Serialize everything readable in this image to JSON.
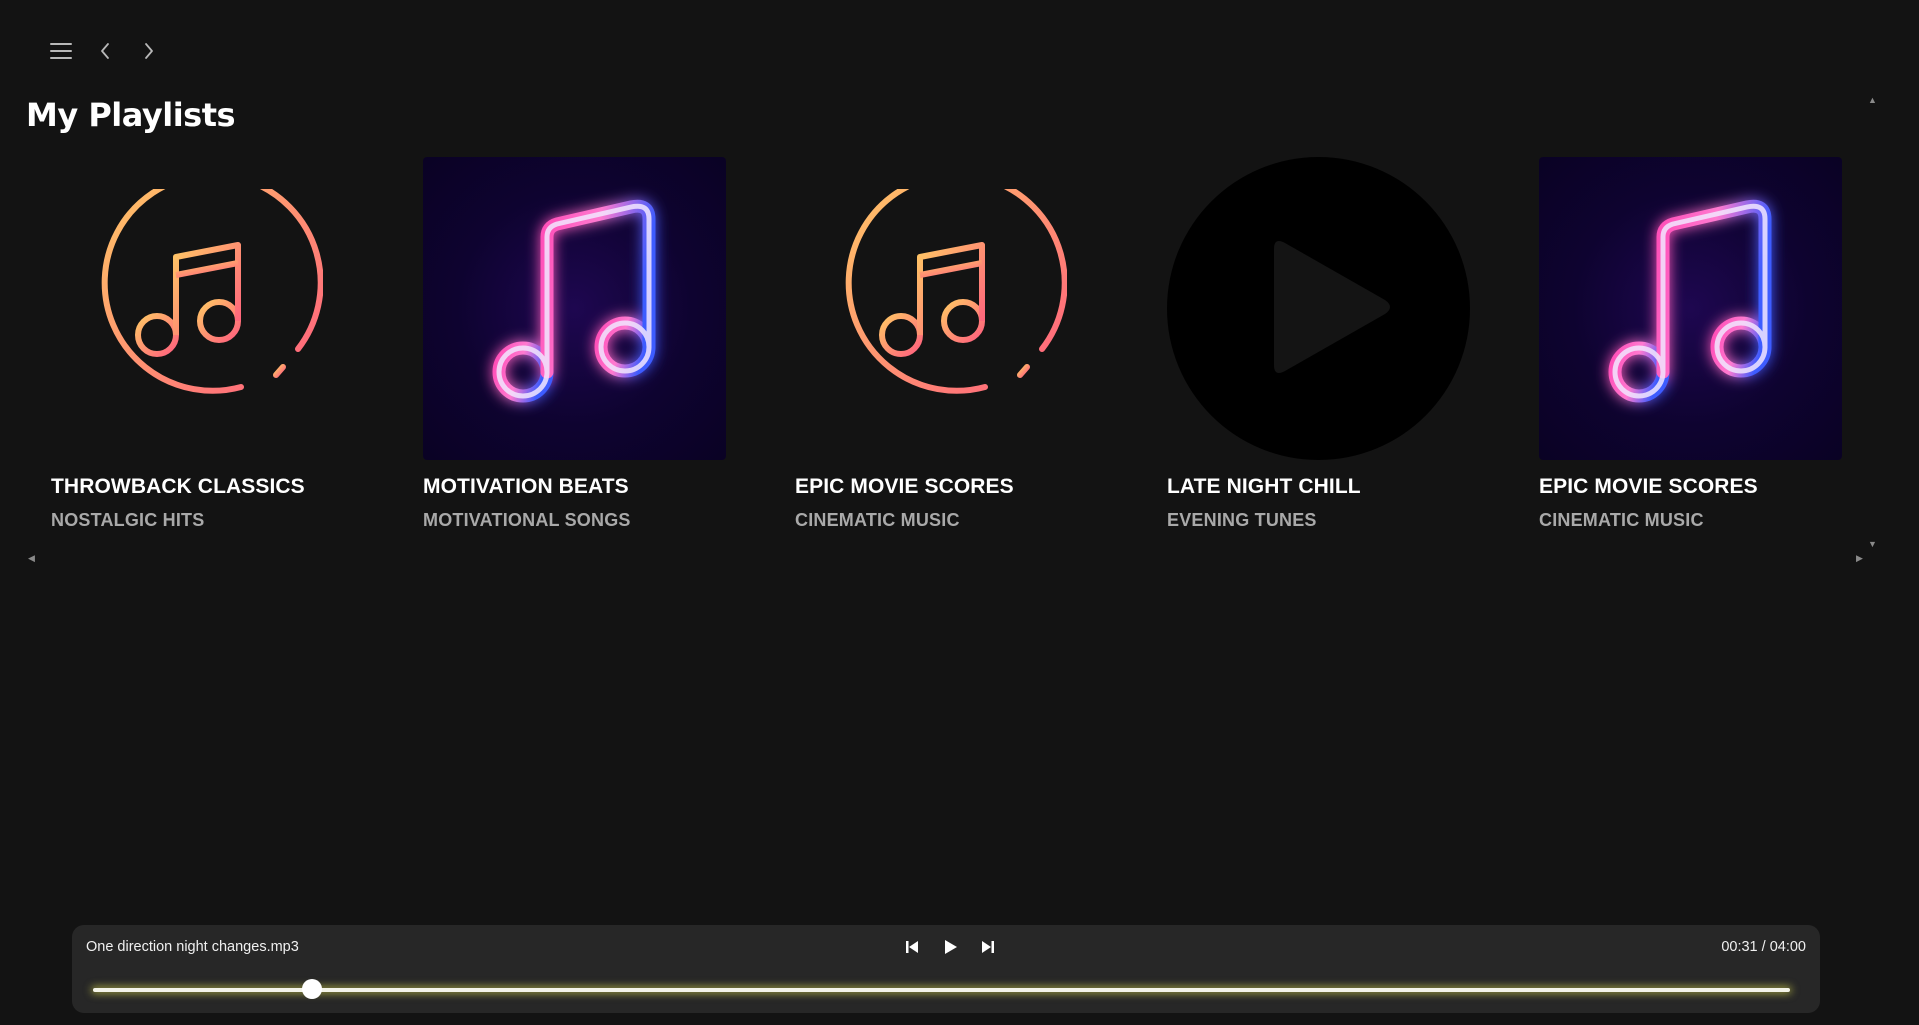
{
  "nav": {
    "menu_icon": "hamburger-menu-icon",
    "back_icon": "chevron-left-icon",
    "forward_icon": "chevron-right-icon"
  },
  "page": {
    "title": "My Playlists"
  },
  "playlists": [
    {
      "title": "THROWBACK CLASSICS",
      "subtitle": "NOSTALGIC HITS",
      "art": "gradient-music-note-circle"
    },
    {
      "title": "MOTIVATION BEATS",
      "subtitle": "MOTIVATIONAL SONGS",
      "art": "neon-music-note"
    },
    {
      "title": "EPIC MOVIE SCORES",
      "subtitle": "CINEMATIC MUSIC",
      "art": "gradient-music-note-circle"
    },
    {
      "title": "LATE NIGHT CHILL",
      "subtitle": "EVENING TUNES",
      "art": "play-circle"
    },
    {
      "title": "EPIC MOVIE SCORES",
      "subtitle": "CINEMATIC MUSIC",
      "art": "neon-music-note"
    }
  ],
  "player": {
    "track": "One direction night changes.mp3",
    "time": "00:31 / 04:00",
    "progress_fraction": 0.129,
    "prev_icon": "skip-previous-icon",
    "play_icon": "play-icon",
    "next_icon": "skip-next-icon"
  },
  "colors": {
    "background": "#131313",
    "player_bg": "#272727",
    "gradient_start": "#ffc765",
    "gradient_end": "#ff5f7e",
    "neon_pink": "#ff4fb8",
    "neon_blue": "#3c5bff",
    "seek_glow": "#e8e850"
  }
}
